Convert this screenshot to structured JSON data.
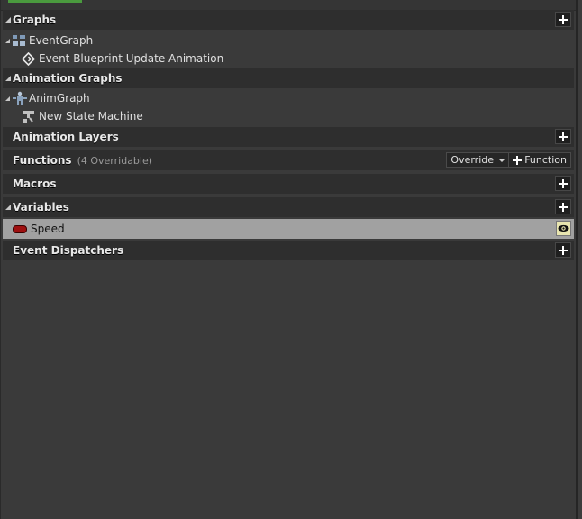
{
  "sections": {
    "graphs": {
      "label": "Graphs",
      "items": [
        {
          "label": "EventGraph",
          "icon": "event-graph-icon"
        },
        {
          "label": "Event Blueprint Update Animation",
          "icon": "event-node-icon"
        }
      ]
    },
    "animation_graphs": {
      "label": "Animation Graphs",
      "items": [
        {
          "label": "AnimGraph",
          "icon": "anim-graph-icon"
        },
        {
          "label": "New State Machine",
          "icon": "state-machine-icon"
        }
      ]
    },
    "animation_layers": {
      "label": "Animation Layers"
    },
    "functions": {
      "label": "Functions",
      "sublabel": "(4 Overridable)",
      "override_label": "Override",
      "add_function_label": "Function"
    },
    "macros": {
      "label": "Macros"
    },
    "variables": {
      "label": "Variables",
      "items": [
        {
          "label": "Speed",
          "type_color": "#9e1010",
          "icon": "float-variable-icon"
        }
      ]
    },
    "event_dispatchers": {
      "label": "Event Dispatchers"
    }
  },
  "colors": {
    "accent_green": "#4a9a3e",
    "selected_row": "#a1a1a1",
    "eye_button": "#e8e5b0"
  }
}
